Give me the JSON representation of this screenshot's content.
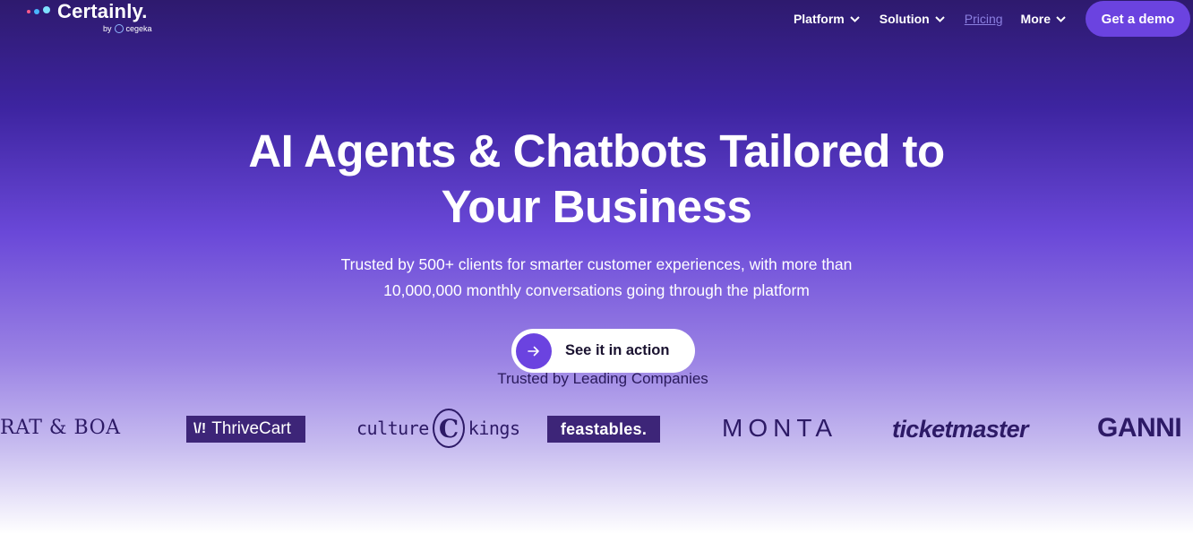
{
  "nav": {
    "logo": {
      "name": "Certainly.",
      "by": "by",
      "partner": "cegeka"
    },
    "items": [
      {
        "label": "Platform",
        "has_dropdown": true
      },
      {
        "label": "Solution",
        "has_dropdown": true
      },
      {
        "label": "Pricing",
        "has_dropdown": false
      },
      {
        "label": "More",
        "has_dropdown": true
      }
    ],
    "cta_label": "Get a demo"
  },
  "hero": {
    "title_line1": "AI Agents & Chatbots Tailored to",
    "title_line2": "Your Business",
    "subtitle_line1": "Trusted by 500+ clients for smarter customer experiences, with more than",
    "subtitle_line2": "10,000,000 monthly conversations going through the platform",
    "cta_label": "See it in action"
  },
  "trusted": {
    "heading": "Trusted by Leading Companies",
    "logos": [
      "RAT & BOA",
      "ThriveCart",
      "culture",
      "C",
      "kings",
      "feastables.",
      "MONTA",
      "ticketmaster",
      "GANNI"
    ]
  },
  "colors": {
    "accent": "#6b43e0",
    "brand_dark": "#2d1a66",
    "pricing_link": "#8b7fe0"
  }
}
